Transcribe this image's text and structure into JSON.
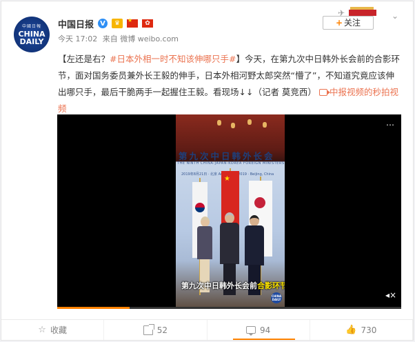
{
  "header": {
    "avatar": {
      "top": "中國日報",
      "line1": "CHINA",
      "line2": "DAILY"
    },
    "name": "中国日报",
    "verified_icon": "v-verified-icon",
    "meta_time": "今天 17:02",
    "meta_from": "来自 微博 weibo.com",
    "follow_label": "关注",
    "follow_plus": "+",
    "chevron": "⌄"
  },
  "post": {
    "bracket_open": "【左还是右？",
    "hashtag": "#日本外相一时不知该伸哪只手#",
    "body": "】今天，在第九次中日韩外长会前的合影环节，面对国务委员兼外长王毅的伸手，日本外相河野太郎突然“懵了”，不知道究竟应该伸出哪只手，最后干脆两手一起握住王毅。看现场↓↓（记者 莫竞西）",
    "video_link": "中报视频的秒拍视频"
  },
  "video": {
    "banner_title": "第九次中日韩外长会",
    "banner_sub": "THE NINTH CHINA-JAPAN-KOREA FOREIGN MINISTERS' MEETING · THE PEOPLE'S REPUBLIC OF CHINA · THE REPUBLIC OF KOREA",
    "banner_date": "2019年8月21日 · 北京   August 21, 2019 · Beijing, China",
    "caption_main": "第九次中日韩外长会前",
    "caption_highlight": "合影环节",
    "logo_line1": "CHINA",
    "logo_line2": "DAILY",
    "menu_icon": "⋯",
    "mute_icon": "🔇",
    "progress": 0.21
  },
  "footer": {
    "items": [
      {
        "name": "favorite",
        "label": "收藏",
        "icon": "star-icon"
      },
      {
        "name": "repost",
        "label": "52",
        "icon": "share-icon"
      },
      {
        "name": "comment",
        "label": "94",
        "icon": "comment-icon"
      },
      {
        "name": "like",
        "label": "730",
        "icon": "thumb-up-icon"
      }
    ]
  },
  "colors": {
    "accent": "#ff8200",
    "link": "#eb7350",
    "verify": "#2e8ff5"
  }
}
